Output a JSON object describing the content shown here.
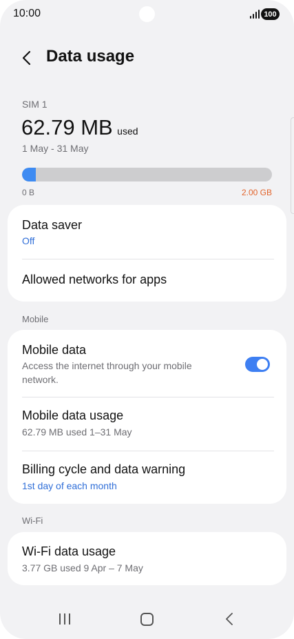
{
  "status_bar": {
    "time": "10:00",
    "battery": "100"
  },
  "header": {
    "title": "Data usage"
  },
  "usage": {
    "sim_label": "SIM 1",
    "amount": "62.79 MB",
    "suffix": "used",
    "period": "1 May - 31 May",
    "progress_fraction": 0.0307,
    "min_label": "0 B",
    "max_label": "2.00 GB"
  },
  "colors": {
    "accent": "#3e8bf2",
    "limit": "#e2632a",
    "link": "#2f6ed8"
  },
  "card_saver": {
    "data_saver": {
      "title": "Data saver",
      "value": "Off"
    },
    "allowed_networks": {
      "title": "Allowed networks for apps"
    }
  },
  "mobile_section": {
    "label": "Mobile",
    "mobile_data": {
      "title": "Mobile data",
      "description": "Access the internet through your mobile network.",
      "enabled": true
    },
    "mobile_data_usage": {
      "title": "Mobile data usage",
      "value": "62.79 MB used 1–31 May"
    },
    "billing_cycle": {
      "title": "Billing cycle and data warning",
      "value": "1st day of each month"
    }
  },
  "wifi_section": {
    "label": "Wi-Fi",
    "wifi_data_usage": {
      "title": "Wi-Fi data usage",
      "value": "3.77 GB used 9 Apr – 7 May"
    }
  },
  "nav_bar": {
    "icons": [
      "recents-icon",
      "home-icon",
      "back-icon"
    ]
  }
}
